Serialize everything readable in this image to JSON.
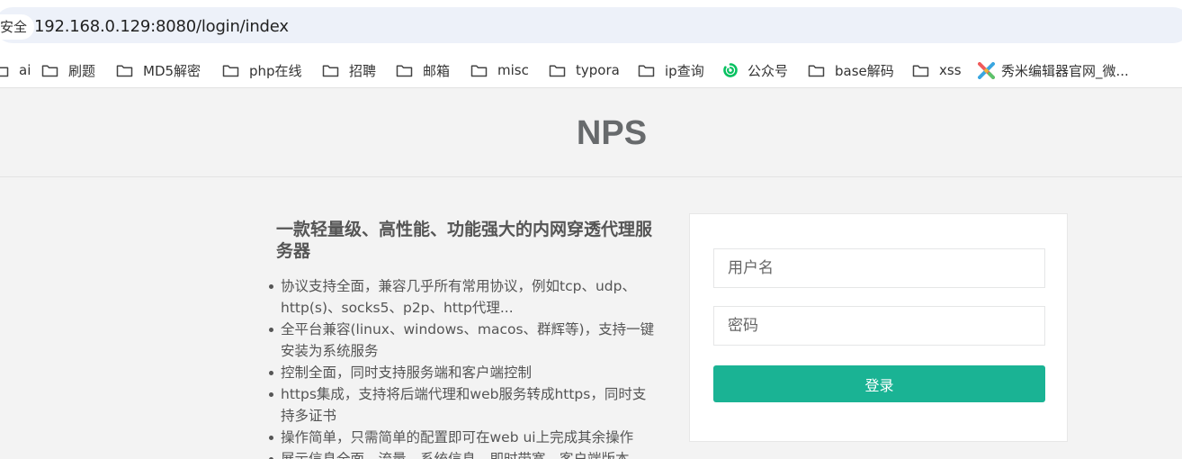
{
  "browser": {
    "security_label": "安全",
    "url": "192.168.0.129:8080/login/index"
  },
  "bookmarks": [
    {
      "label": "ai",
      "icon": "folder-icon"
    },
    {
      "label": "刷题",
      "icon": "folder-icon"
    },
    {
      "label": "MD5解密",
      "icon": "folder-icon"
    },
    {
      "label": "php在线",
      "icon": "folder-icon"
    },
    {
      "label": "招聘",
      "icon": "folder-icon"
    },
    {
      "label": "邮箱",
      "icon": "folder-icon"
    },
    {
      "label": "misc",
      "icon": "folder-icon"
    },
    {
      "label": "typora",
      "icon": "folder-icon"
    },
    {
      "label": "ip查询",
      "icon": "folder-icon"
    },
    {
      "label": "公众号",
      "icon": "wechat-icon"
    },
    {
      "label": "base解码",
      "icon": "folder-icon"
    },
    {
      "label": "xss",
      "icon": "folder-icon"
    },
    {
      "label": "秀米编辑器官网_微...",
      "icon": "xiumi-icon"
    }
  ],
  "header": {
    "brand": "NPS"
  },
  "intro": {
    "title": "一款轻量级、高性能、功能强大的内网穿透代理服务器",
    "features": [
      "协议支持全面，兼容几乎所有常用协议，例如tcp、udp、http(s)、socks5、p2p、http代理...",
      "全平台兼容(linux、windows、macos、群辉等)，支持一键安装为系统服务",
      "控制全面，同时支持服务端和客户端控制",
      "https集成，支持将后端代理和web服务转成https，同时支持多证书",
      "操作简单，只需简单的配置即可在web ui上完成其余操作",
      "展示信息全面，流量、系统信息、即时带宽、客户端版本"
    ]
  },
  "login": {
    "username_placeholder": "用户名",
    "password_placeholder": "密码",
    "submit_label": "登录"
  },
  "colors": {
    "accent": "#1ab394",
    "brand_text": "#676a6c",
    "page_bg": "#f3f3f3",
    "wechat_green": "#07c160"
  }
}
